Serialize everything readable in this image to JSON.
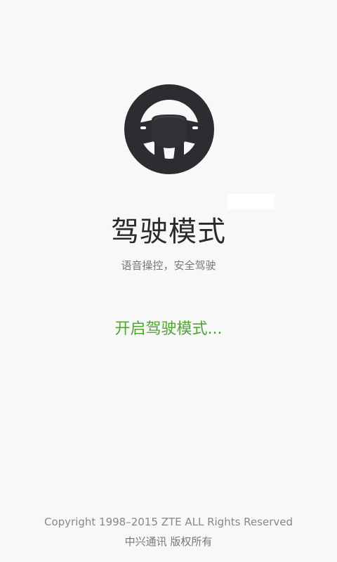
{
  "icon": "steering-wheel-icon",
  "title": "驾驶模式",
  "subtitle": "语音操控，安全驾驶",
  "status": "开启驾驶模式...",
  "footer": {
    "copyright": "Copyright 1998–2015 ZTE ALL Rights Reserved",
    "company": "中兴通讯 版权所有"
  },
  "colors": {
    "background": "#f8f8f8",
    "wheel": "#2b2d31",
    "title": "#2a2a2a",
    "status": "#52a437",
    "footer": "#888888"
  }
}
